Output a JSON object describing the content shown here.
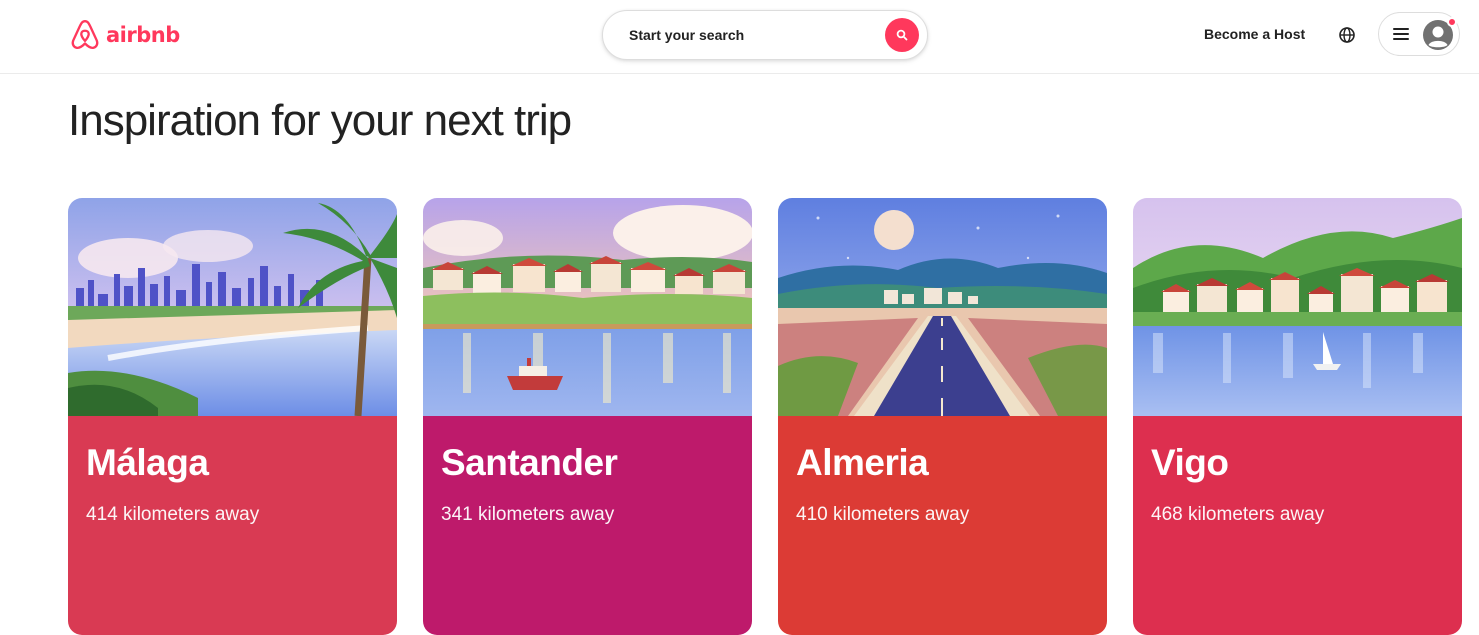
{
  "header": {
    "logo_text": "airbnb",
    "search_placeholder": "Start your search",
    "host_label": "Become a Host"
  },
  "page": {
    "title": "Inspiration for your next trip"
  },
  "cards": [
    {
      "city": "Málaga",
      "distance": "414 kilometers away",
      "color": "#d93a53"
    },
    {
      "city": "Santander",
      "distance": "341 kilometers away",
      "color": "#be1a6b"
    },
    {
      "city": "Almeria",
      "distance": "410 kilometers away",
      "color": "#dc3b35"
    },
    {
      "city": "Vigo",
      "distance": "468 kilometers away",
      "color": "#dd2f4f"
    }
  ],
  "colors": {
    "brand": "#ff385c"
  },
  "icons": [
    "airbnb-logo-icon",
    "search-icon",
    "globe-icon",
    "menu-icon",
    "avatar-icon"
  ]
}
